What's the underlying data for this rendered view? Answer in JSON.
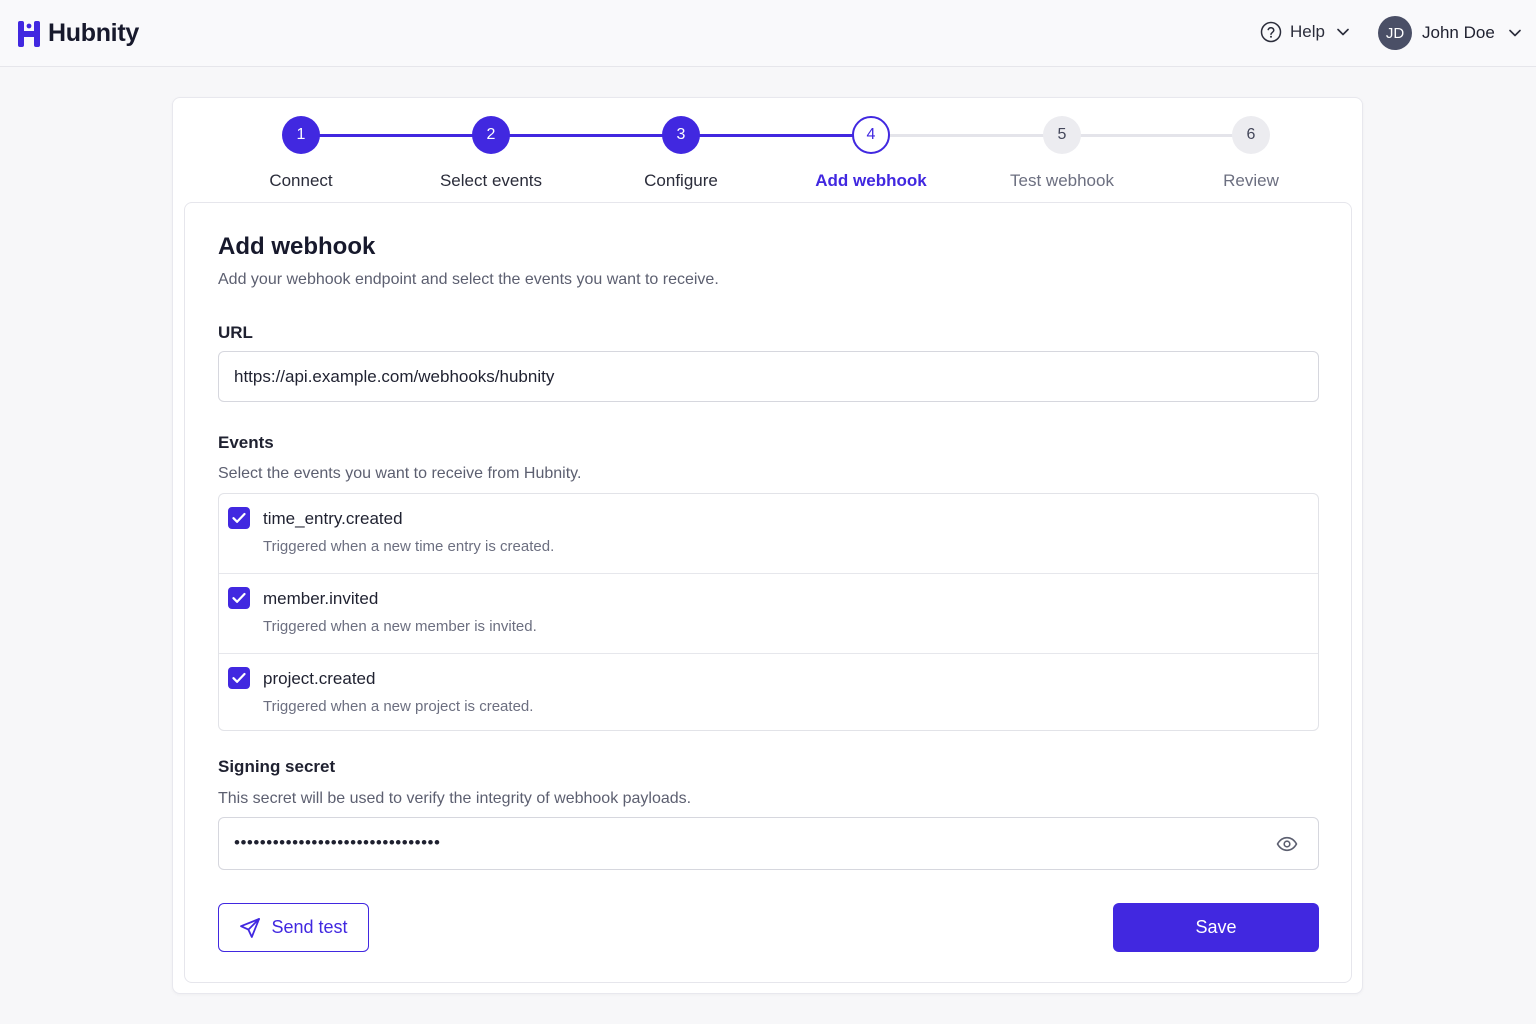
{
  "app": {
    "name": "Hubnity"
  },
  "header": {
    "help_label": "Help",
    "user": {
      "initials": "JD",
      "name": "John Doe"
    }
  },
  "stepper": {
    "steps": [
      {
        "number": "1",
        "label": "Connect",
        "state": "done"
      },
      {
        "number": "2",
        "label": "Select events",
        "state": "done"
      },
      {
        "number": "3",
        "label": "Configure",
        "state": "done"
      },
      {
        "number": "4",
        "label": "Add webhook",
        "state": "current"
      },
      {
        "number": "5",
        "label": "Test webhook",
        "state": "todo"
      },
      {
        "number": "6",
        "label": "Review",
        "state": "todo"
      }
    ]
  },
  "form": {
    "title": "Add webhook",
    "subtitle": "Add your webhook endpoint and select the events you want to receive.",
    "url": {
      "label": "URL",
      "value": "https://api.example.com/webhooks/hubnity"
    },
    "events": {
      "label": "Events",
      "help": "Select the events you want to receive from Hubnity.",
      "items": [
        {
          "name": "time_entry.created",
          "description": "Triggered when a new time entry is created.",
          "checked": true
        },
        {
          "name": "member.invited",
          "description": "Triggered when a new member is invited.",
          "checked": true
        },
        {
          "name": "project.created",
          "description": "Triggered when a new project is created.",
          "checked": true
        }
      ]
    },
    "secret": {
      "label": "Signing secret",
      "help": "This secret will be used to verify the integrity of webhook payloads.",
      "masked_value": "••••••••••••••••••••••••••••••••"
    },
    "send_test_label": "Send test",
    "save_label": "Save"
  },
  "colors": {
    "accent": "#4128e0",
    "step_todo": "#ececf0",
    "avatar": "#4a4f66"
  },
  "icons": {
    "logo": "hubnity-logo-icon",
    "help": "help-circle-icon",
    "chevron": "chevron-down-icon",
    "check": "check-icon",
    "eye": "eye-icon",
    "send": "send-icon"
  }
}
